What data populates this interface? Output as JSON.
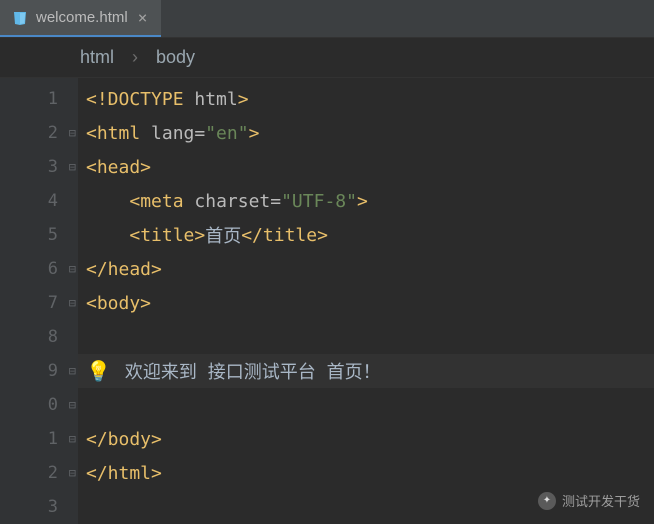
{
  "tab": {
    "label": "welcome.html",
    "close": "×"
  },
  "breadcrumb": {
    "items": [
      "html",
      "body"
    ],
    "sep": "›"
  },
  "gutter": {
    "lines": [
      "1",
      "2",
      "3",
      "4",
      "5",
      "6",
      "7",
      "8",
      "9",
      "0",
      "1",
      "2",
      "3"
    ],
    "folds": {
      "1": "⊟",
      "2": "⊟",
      "6": "⊟",
      "9": "⊟",
      "10": "⊟",
      "11": "⊟"
    }
  },
  "code": {
    "l1": {
      "a": "<!DOCTYPE ",
      "b": "html",
      "c": ">"
    },
    "l2": {
      "a": "<html ",
      "b": "lang=",
      "c": "\"en\"",
      "d": ">"
    },
    "l3": {
      "a": "<head>"
    },
    "l4": {
      "sp": "    ",
      "a": "<meta ",
      "b": "charset=",
      "c": "\"UTF-8\"",
      "d": ">"
    },
    "l5": {
      "sp": "    ",
      "a": "<title>",
      "b": "首页",
      "c": "</title>"
    },
    "l6": {
      "a": "</head>"
    },
    "l7": {
      "a": "<body>"
    },
    "l9": {
      "text": "欢迎来到 接口测试平台 首页！"
    },
    "l11": {
      "a": "</body>"
    },
    "l12": {
      "a": "</html>"
    }
  },
  "watermark": {
    "text": "测试开发干货"
  }
}
